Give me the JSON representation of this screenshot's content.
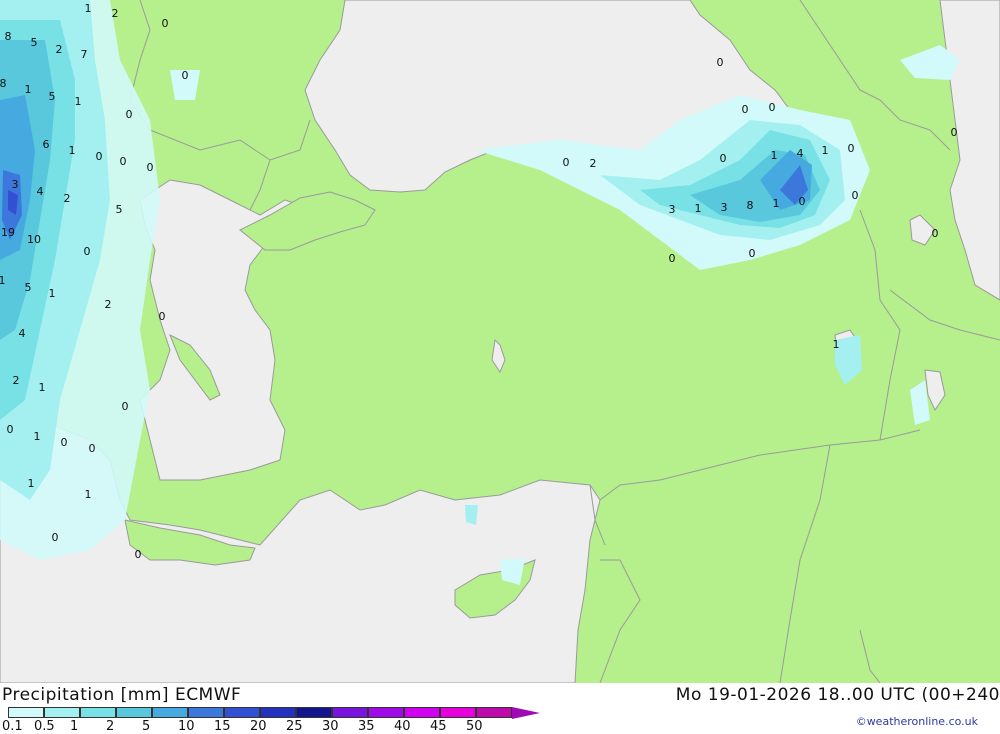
{
  "header": {
    "title": "Precipitation [mm] ECMWF",
    "datetime": "Mo 19-01-2026 18..00 UTC (00+240"
  },
  "credit": "©weatheronline.co.uk",
  "legend": {
    "labels": [
      "0.1",
      "0.5",
      "1",
      "2",
      "5",
      "10",
      "15",
      "20",
      "25",
      "30",
      "35",
      "40",
      "45",
      "50"
    ],
    "colors": [
      "#d2fafa",
      "#a4f0f0",
      "#78e1e6",
      "#5ac8dc",
      "#46aae1",
      "#3c78dc",
      "#3250d2",
      "#2332be",
      "#14148c",
      "#7814dc",
      "#a00ae6",
      "#d200f0",
      "#e600dc",
      "#be0aaa"
    ]
  },
  "map_colors": {
    "land": "#b5f08c",
    "sea": "#eeeeee",
    "border": "#9a9a9a"
  },
  "map_values": [
    {
      "v": "1"
    },
    {
      "v": "2"
    },
    {
      "v": "0"
    },
    {
      "v": "8"
    },
    {
      "v": "5"
    },
    {
      "v": "2"
    },
    {
      "v": "7"
    },
    {
      "v": "8"
    },
    {
      "v": "1"
    },
    {
      "v": "5"
    },
    {
      "v": "1"
    },
    {
      "v": "0"
    },
    {
      "v": "0"
    },
    {
      "v": "6"
    },
    {
      "v": "1"
    },
    {
      "v": "0"
    },
    {
      "v": "0"
    },
    {
      "v": "0"
    },
    {
      "v": "3"
    },
    {
      "v": "4"
    },
    {
      "v": "2"
    },
    {
      "v": "5"
    },
    {
      "v": "19"
    },
    {
      "v": "10"
    },
    {
      "v": "0"
    },
    {
      "v": "1"
    },
    {
      "v": "5"
    },
    {
      "v": "1"
    },
    {
      "v": "2"
    },
    {
      "v": "0"
    },
    {
      "v": "4"
    },
    {
      "v": "2"
    },
    {
      "v": "1"
    },
    {
      "v": "0"
    },
    {
      "v": "0"
    },
    {
      "v": "1"
    },
    {
      "v": "0"
    },
    {
      "v": "0"
    },
    {
      "v": "1"
    },
    {
      "v": "1"
    },
    {
      "v": "0"
    },
    {
      "v": "0"
    },
    {
      "v": "0"
    },
    {
      "v": "0"
    },
    {
      "v": "0"
    },
    {
      "v": "0"
    },
    {
      "v": "2"
    },
    {
      "v": "0"
    },
    {
      "v": "1"
    },
    {
      "v": "4"
    },
    {
      "v": "1"
    },
    {
      "v": "0"
    },
    {
      "v": "0"
    },
    {
      "v": "3"
    },
    {
      "v": "1"
    },
    {
      "v": "3"
    },
    {
      "v": "8"
    },
    {
      "v": "1"
    },
    {
      "v": "0"
    },
    {
      "v": "0"
    },
    {
      "v": "0"
    },
    {
      "v": "0"
    },
    {
      "v": "0"
    },
    {
      "v": "1"
    }
  ]
}
